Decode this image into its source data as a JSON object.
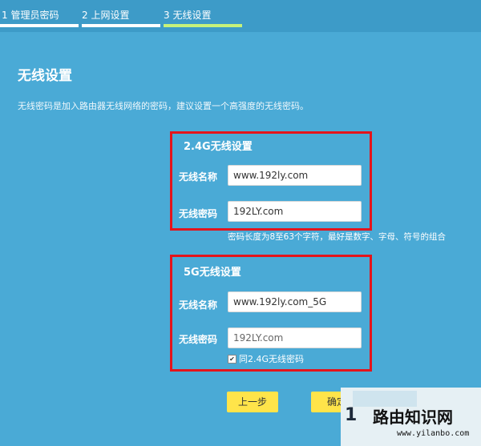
{
  "steps": [
    {
      "label": "1 管理员密码",
      "state": "done"
    },
    {
      "label": "2 上网设置",
      "state": "done"
    },
    {
      "label": "3 无线设置",
      "state": "active"
    }
  ],
  "page": {
    "title": "无线设置",
    "description": "无线密码是加入路由器无线网络的密码，建议设置一个高强度的无线密码。"
  },
  "band24": {
    "title": "2.4G无线设置",
    "name_label": "无线名称",
    "name_value": "www.192ly.com",
    "password_label": "无线密码",
    "password_value": "192LY.com",
    "hint": "密码长度为8至63个字符，最好是数字、字母、符号的组合"
  },
  "band5": {
    "title": "5G无线设置",
    "name_label": "无线名称",
    "name_value": "www.192ly.com_5G",
    "password_label": "无线密码",
    "password_value": "192LY.com",
    "same_password_label": "同2.4G无线密码",
    "same_password_checked": true
  },
  "buttons": {
    "prev": "上一步",
    "confirm": "确定"
  },
  "watermark": {
    "title": "路由知识网",
    "url": "www.yilanbo.com",
    "digits": "1"
  },
  "colors": {
    "background": "#4aaad6",
    "highlight": "#e4141b",
    "button": "#ffe44a",
    "active_step": "#c6f27a"
  }
}
